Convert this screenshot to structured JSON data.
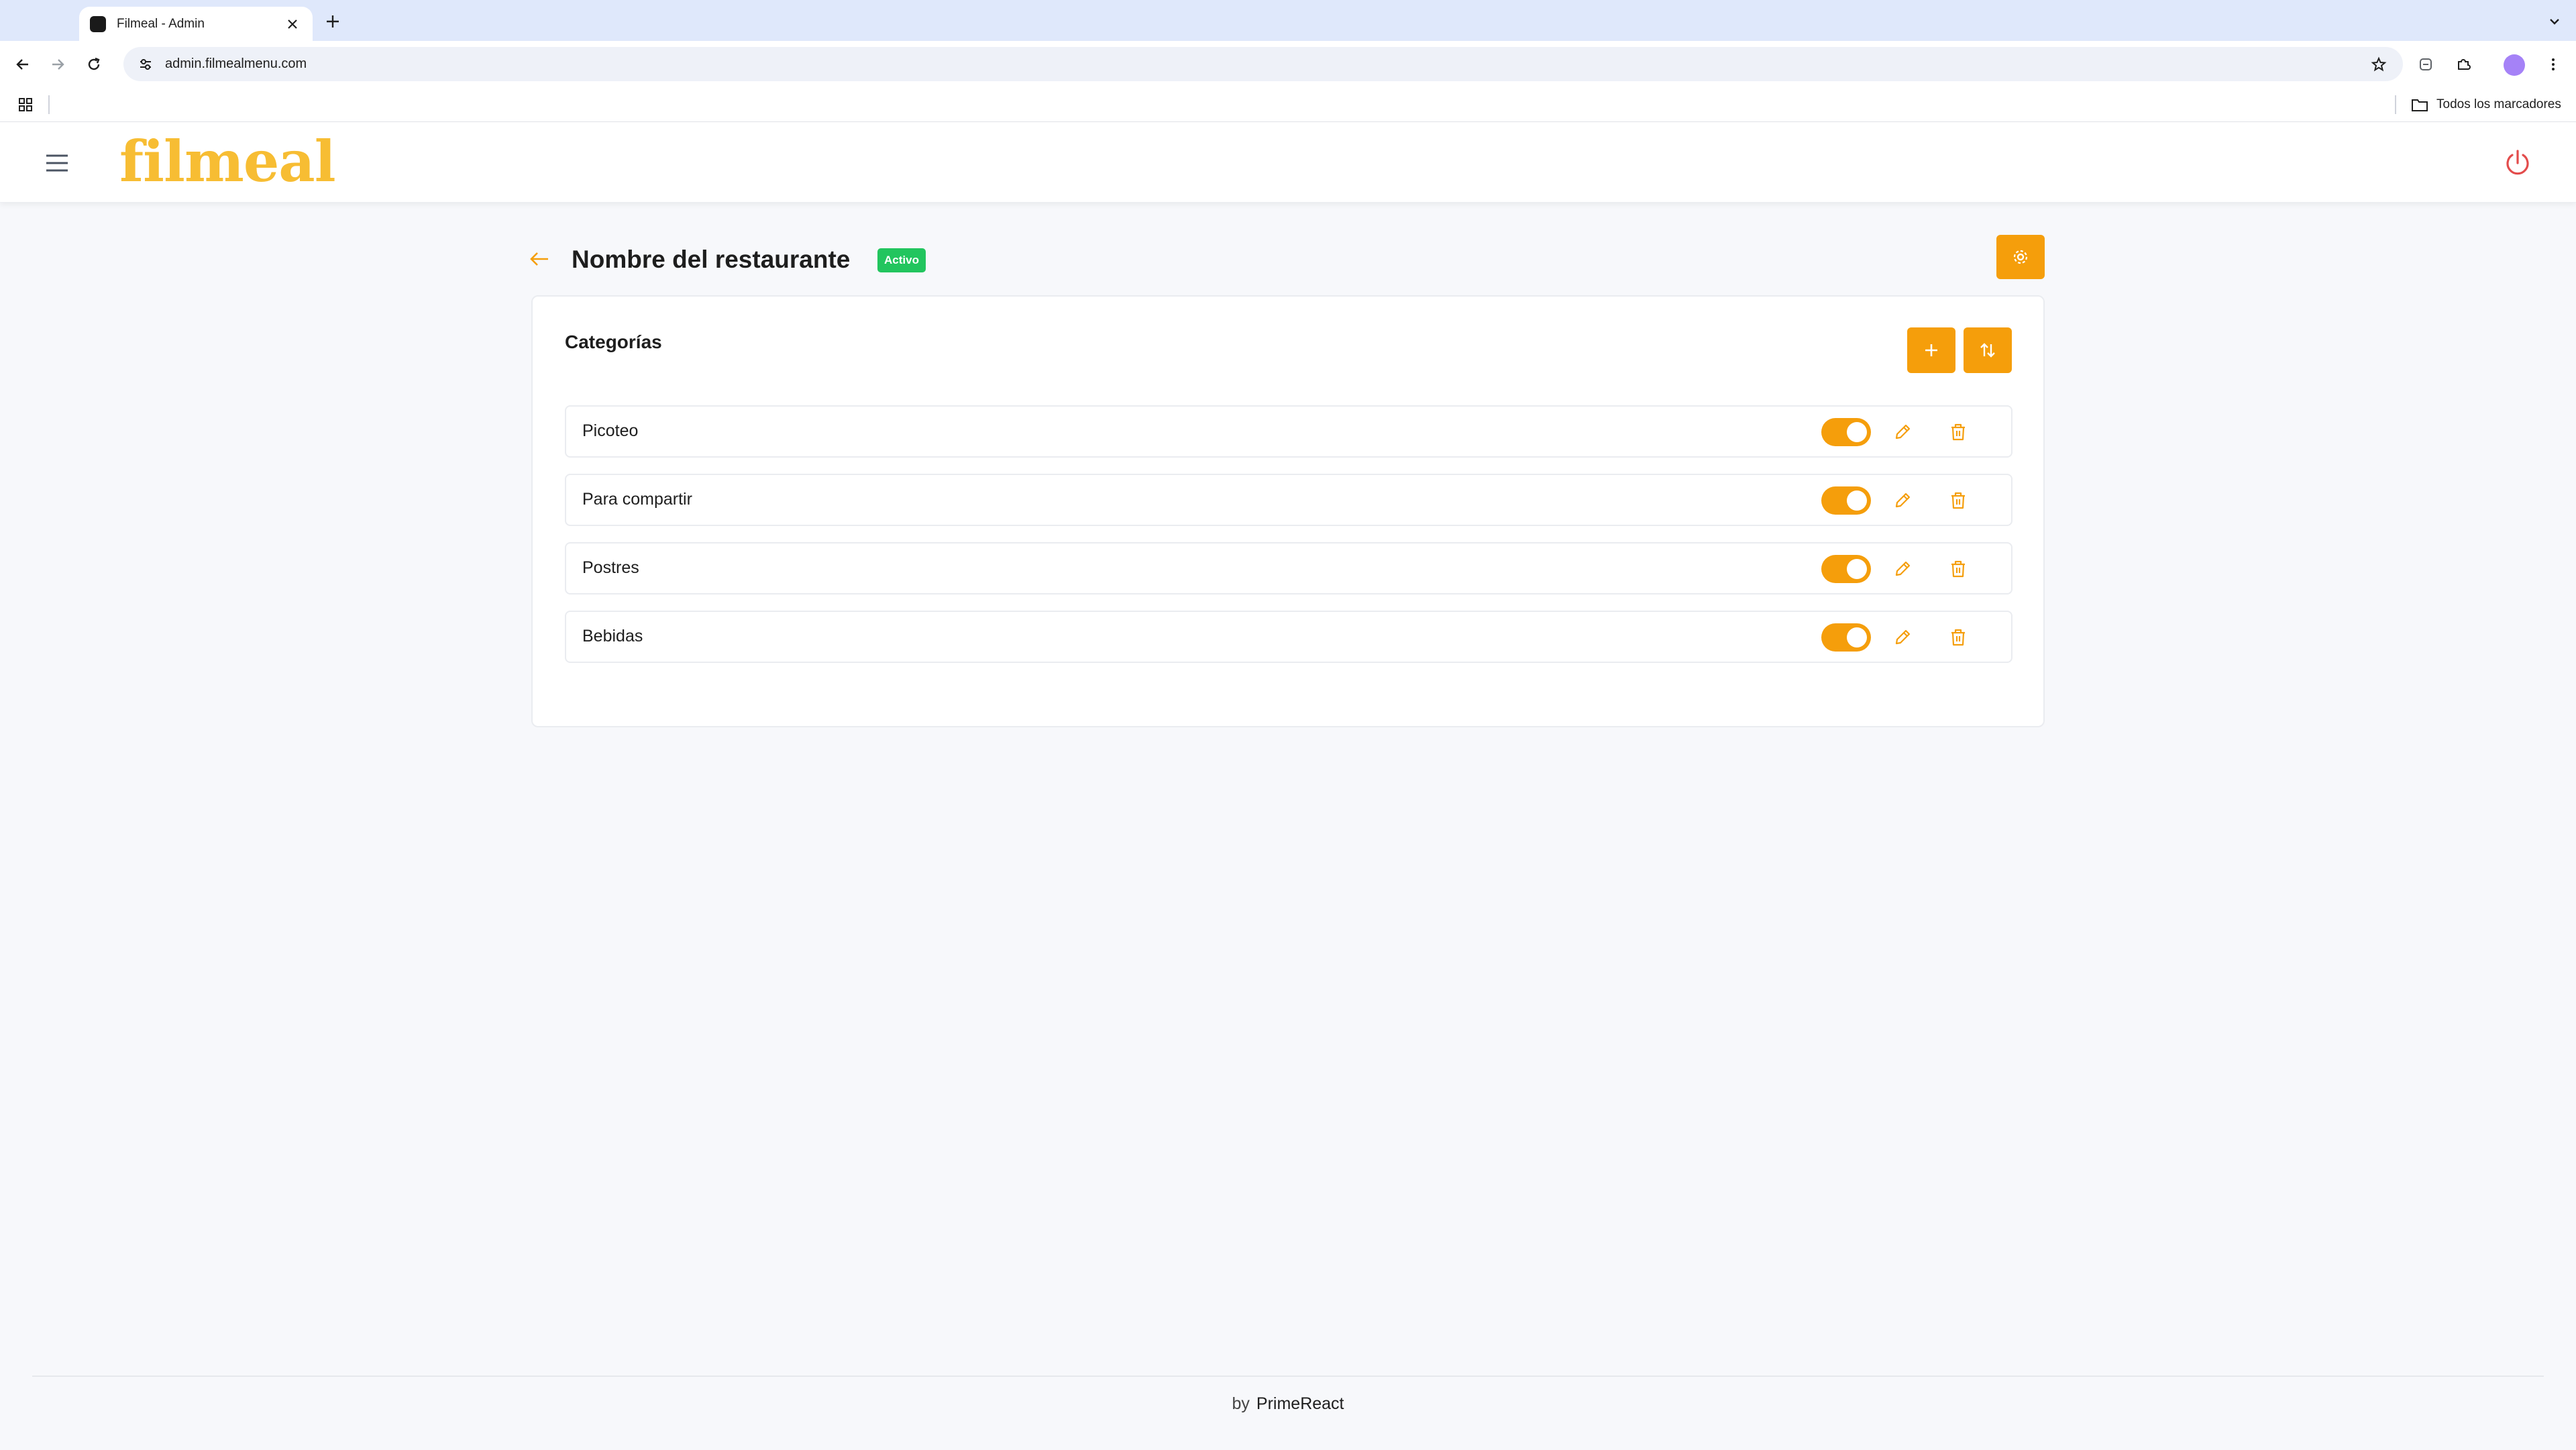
{
  "browser": {
    "tab_title": "Filmeal - Admin",
    "url": "admin.filmealmenu.com",
    "bookmarks_all_label": "Todos los marcadores"
  },
  "app": {
    "logo_text": "filmeal",
    "accent_color": "#f59e0b",
    "logo_color": "#f7bd33"
  },
  "page": {
    "title": "Nombre del restaurante",
    "status_badge": "Activo",
    "status_color": "#22c55e"
  },
  "categories": {
    "title": "Categorías",
    "items": [
      {
        "name": "Picoteo",
        "enabled": true
      },
      {
        "name": "Para compartir",
        "enabled": true
      },
      {
        "name": "Postres",
        "enabled": true
      },
      {
        "name": "Bebidas",
        "enabled": true
      }
    ]
  },
  "footer": {
    "by": "by",
    "brand": "PrimeReact"
  }
}
